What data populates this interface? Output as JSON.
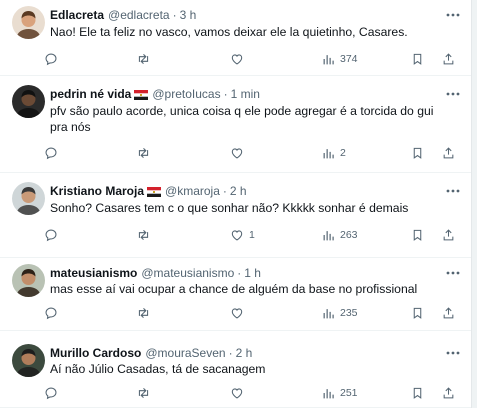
{
  "tweets": [
    {
      "name": "Edlacreta",
      "handle": "@edlacreta",
      "time": "3 h",
      "flag": false,
      "text": "Nao! Ele ta feliz no vasco, vamos deixar ele la quietinho, Casares.",
      "replies": "",
      "retweets": "",
      "likes": "",
      "views": "374",
      "avatar": {
        "bg": "#e9ddd0",
        "skin": "#d9a27c",
        "hair": "#5a3a22"
      }
    },
    {
      "name": "pedrin né vida",
      "handle": "@pretoIucas",
      "time": "1 min",
      "flag": true,
      "text": "pfv são paulo acorde, unica coisa q ele pode agregar é a torcida do gui pra nós",
      "replies": "",
      "retweets": "",
      "likes": "",
      "views": "2",
      "avatar": {
        "bg": "#2b2b2b",
        "skin": "#6b4a35",
        "hair": "#111111"
      }
    },
    {
      "name": "Kristiano Maroja",
      "handle": "@kmaroja",
      "time": "2 h",
      "flag": true,
      "text": "Sonho? Casares tem c o que sonhar não? Kkkkk sonhar é demais",
      "replies": "",
      "retweets": "",
      "likes": "1",
      "views": "263",
      "avatar": {
        "bg": "#cfd6d8",
        "skin": "#c99a78",
        "hair": "#3a3a3a"
      }
    },
    {
      "name": "mateusianismo",
      "handle": "@mateusianismo",
      "time": "1 h",
      "flag": false,
      "text": "mas esse aí vai ocupar a chance de alguém da base no profissional",
      "replies": "",
      "retweets": "",
      "likes": "",
      "views": "235",
      "avatar": {
        "bg": "#b9c2b4",
        "skin": "#c28e6a",
        "hair": "#2e2218"
      }
    },
    {
      "name": "Murillo Cardoso",
      "handle": "@mouraSeven",
      "time": "2 h",
      "flag": false,
      "text": "Aí não Júlio Casadas, tá de sacanagem",
      "replies": "",
      "retweets": "",
      "likes": "",
      "views": "251",
      "avatar": {
        "bg": "#3c4a3e",
        "skin": "#b07d5b",
        "hair": "#1d1d1d"
      }
    }
  ],
  "colors": {
    "icon": "#536471",
    "text": "#0f1419",
    "divider": "#eff3f4"
  },
  "icons": [
    "reply-icon",
    "retweet-icon",
    "like-icon",
    "views-icon",
    "bookmark-icon",
    "share-icon",
    "more-icon"
  ]
}
